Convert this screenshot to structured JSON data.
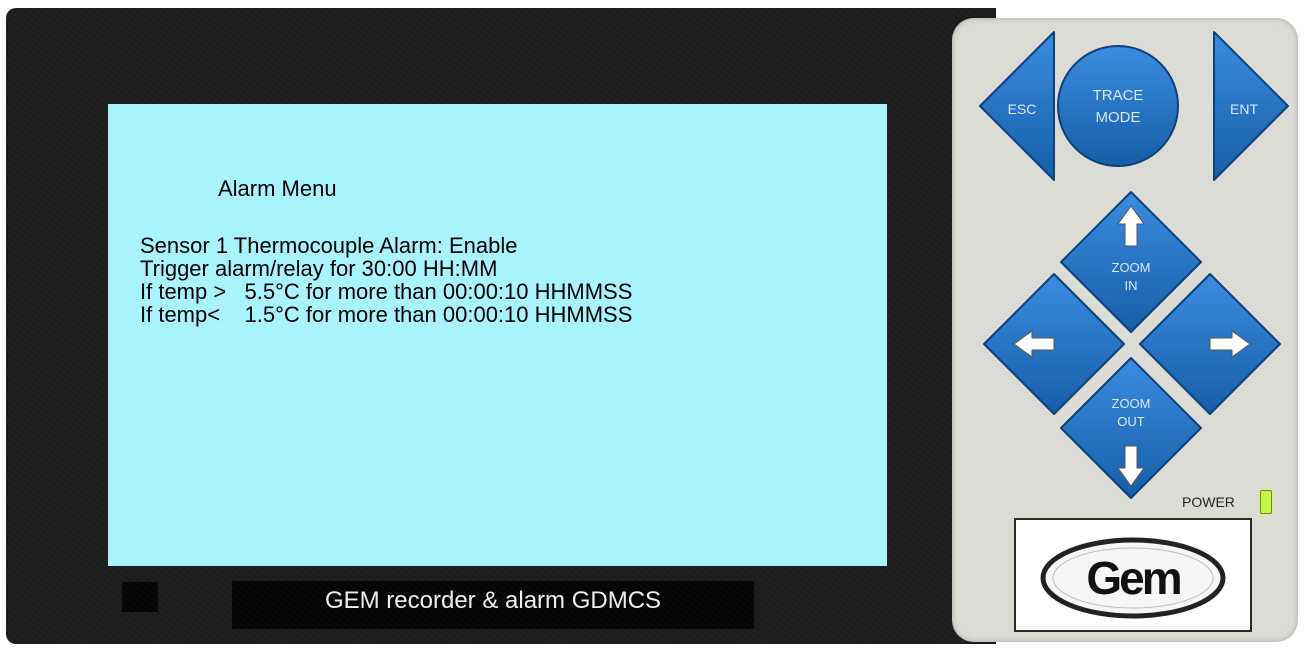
{
  "screen": {
    "title": "Alarm Menu",
    "lines": [
      "Sensor 1 Thermocouple Alarm: Enable",
      "Trigger alarm/relay for 30:00 HH:MM",
      "If temp >   5.5°C for more than 00:00:10 HHMMSS",
      "If temp<    1.5°C for more than 00:00:10 HHMMSS"
    ],
    "background": "#a8f3fc"
  },
  "footer_label": "GEM recorder & alarm GDMCS",
  "keypad": {
    "esc": "ESC",
    "trace_mode_line1": "TRACE",
    "trace_mode_line2": "MODE",
    "ent": "ENT",
    "zoom_in_line1": "ZOOM",
    "zoom_in_line2": "IN",
    "zoom_out_line1": "ZOOM",
    "zoom_out_line2": "OUT",
    "button_color": "#1f6fc1"
  },
  "power_label": "POWER",
  "logo_text": "Gem"
}
